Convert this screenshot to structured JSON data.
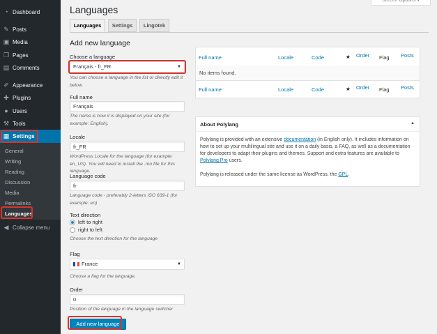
{
  "sidebar": {
    "items": [
      {
        "label": "Dashboard",
        "icon": "dashboard-icon",
        "glyph": "◔"
      },
      {
        "label": "Posts",
        "icon": "pushpin-icon",
        "glyph": "✎"
      },
      {
        "label": "Media",
        "icon": "media-icon",
        "glyph": "▣"
      },
      {
        "label": "Pages",
        "icon": "pages-icon",
        "glyph": "❐"
      },
      {
        "label": "Comments",
        "icon": "comments-icon",
        "glyph": "▤"
      },
      {
        "label": "Appearance",
        "icon": "appearance-icon",
        "glyph": "✐"
      },
      {
        "label": "Plugins",
        "icon": "plugins-icon",
        "glyph": "✚"
      },
      {
        "label": "Users",
        "icon": "users-icon",
        "glyph": "●"
      },
      {
        "label": "Tools",
        "icon": "tools-icon",
        "glyph": "⚒"
      },
      {
        "label": "Settings",
        "icon": "settings-icon",
        "glyph": "▦"
      }
    ],
    "submenu": [
      "General",
      "Writing",
      "Reading",
      "Discussion",
      "Media",
      "Permalinks",
      "Languages"
    ],
    "collapse": {
      "label": "Collapse menu",
      "glyph": "◀"
    }
  },
  "header": {
    "screen_options": "Screen Options ▾",
    "title": "Languages"
  },
  "tabs": [
    "Languages",
    "Settings",
    "Lingotek"
  ],
  "form": {
    "heading": "Add new language",
    "choose_label": "Choose a language",
    "choose_value": "Français - fr_FR",
    "choose_desc": "You can choose a language in the list or directly edit it below.",
    "fullname_label": "Full name",
    "fullname_value": "Français",
    "fullname_desc": "The name is how it is displayed on your site (for example: English).",
    "locale_label": "Locale",
    "locale_value": "fr_FR",
    "locale_desc": "WordPress Locale for the language (for example: en_US). You will need to install the .mo file for this language.",
    "code_label": "Language code",
    "code_value": "fr",
    "code_desc": "Language code - preferably 2-letters ISO 639-1 (for example: en)",
    "direction_label": "Text direction",
    "ltr_label": "left to right",
    "rtl_label": "right to left",
    "direction_desc": "Choose the text direction for the language",
    "flag_label": "Flag",
    "flag_value": "France",
    "flag_desc": "Choose a flag for the language.",
    "order_label": "Order",
    "order_value": "0",
    "order_desc": "Position of the language in the language switcher",
    "submit": "Add new language"
  },
  "table": {
    "columns": [
      "Full name",
      "Locale",
      "Code",
      "★",
      "Order",
      "Flag",
      "Posts"
    ],
    "empty": "No items found."
  },
  "about": {
    "title": "About Polylang",
    "p1_a": "Polylang is provided with an extensive ",
    "p1_link1": "documentation",
    "p1_b": " (in English only). It includes information on how to set up your multilingual site and use it on a daily basis, a FAQ, as well as a documentation for developers to adapt their plugins and themes. Support and extra features are available to ",
    "p1_link2": "Polylang Pro",
    "p1_c": " users.",
    "p2_a": "Polylang is released under the same license as WordPress, the ",
    "p2_link": "GPL",
    "p2_b": "."
  },
  "colors": {
    "accent": "#0073aa",
    "highlight": "#d9342b",
    "sidebar": "#23282d"
  }
}
